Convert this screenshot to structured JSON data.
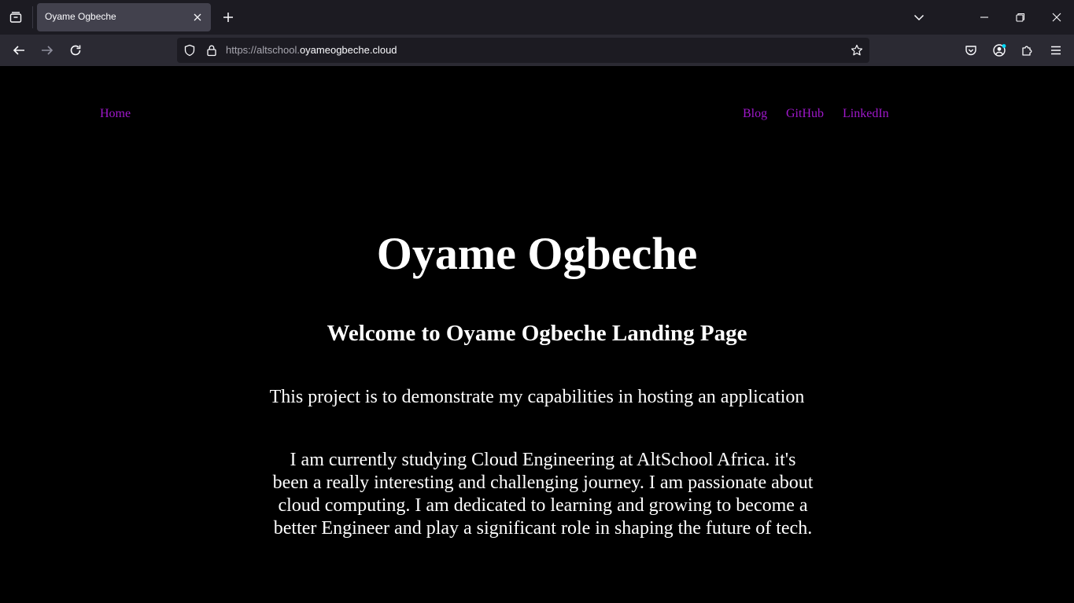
{
  "browser": {
    "tab_title": "Oyame Ogbeche",
    "url_prefix": "https://altschool.",
    "url_domain": "oyameogbeche.cloud"
  },
  "icons": {
    "tab_list": "tab-list-icon",
    "close_tab": "close-icon",
    "new_tab": "plus-icon",
    "list_all_tabs": "chevron-down-icon",
    "minimize": "minimize-icon",
    "restore": "restore-icon",
    "close_window": "close-icon",
    "back": "arrow-left-icon",
    "forward": "arrow-right-icon",
    "reload": "reload-icon",
    "tracking_protection": "shield-icon",
    "secure": "lock-icon",
    "bookmark": "star-icon",
    "pocket": "pocket-icon",
    "account": "account-icon",
    "extensions": "puzzle-icon",
    "menu": "hamburger-menu-icon"
  },
  "colors": {
    "link": "#a018cc",
    "background": "#000000",
    "text": "#ffffff"
  },
  "site": {
    "nav": {
      "home": "Home",
      "blog": "Blog",
      "github": "GitHub",
      "linkedin": "LinkedIn"
    },
    "title": "Oyame Ogbeche",
    "subtitle": "Welcome to Oyame Ogbeche Landing Page",
    "description": "This project is to demonstrate my capabilities in hosting an application",
    "about": "I am currently studying Cloud Engineering at AltSchool Africa. it's been a really interesting and challenging journey. I am passionate about cloud computing. I am dedicated to learning and growing to become a better Engineer and play a significant role in shaping the future of tech."
  }
}
